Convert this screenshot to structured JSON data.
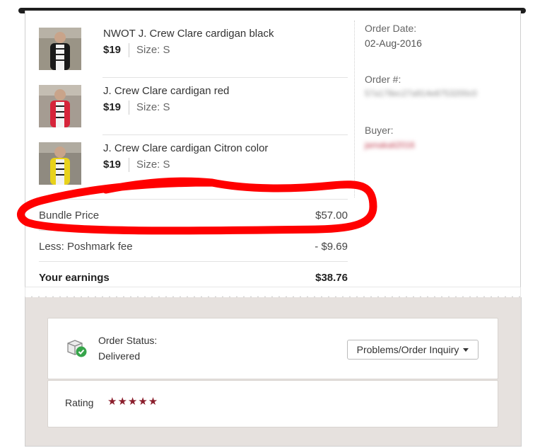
{
  "items": [
    {
      "title": "NWOT J. Crew Clare cardigan black",
      "price": "$19",
      "size": "Size: S",
      "color": "#1a1a1a"
    },
    {
      "title": "J. Crew Clare cardigan red",
      "price": "$19",
      "size": "Size: S",
      "color": "#d6243a"
    },
    {
      "title": "J. Crew Clare cardigan Citron color",
      "price": "$19",
      "size": "Size: S",
      "color": "#e8d21a"
    }
  ],
  "order": {
    "date_label": "Order Date:",
    "date_value": "02-Aug-2016",
    "number_label": "Order #:",
    "number_value": "57a178ec27a914e8753200c0",
    "buyer_label": "Buyer:",
    "buyer_value": "jamakali2016"
  },
  "summary": {
    "bundle_label": "Bundle Price",
    "bundle_value": "$57.00",
    "fee_label": "Less: Poshmark fee",
    "fee_value": "- $9.69",
    "earnings_label": "Your earnings",
    "earnings_value": "$38.76"
  },
  "status": {
    "label": "Order Status:",
    "value": "Delivered",
    "inquiry_button": "Problems/Order Inquiry"
  },
  "rating": {
    "label": "Rating",
    "stars": "★★★★★",
    "star_color": "#8b1e2c"
  },
  "colors": {
    "annotation_red": "#ff0000",
    "background_gray": "#e6e1de"
  }
}
